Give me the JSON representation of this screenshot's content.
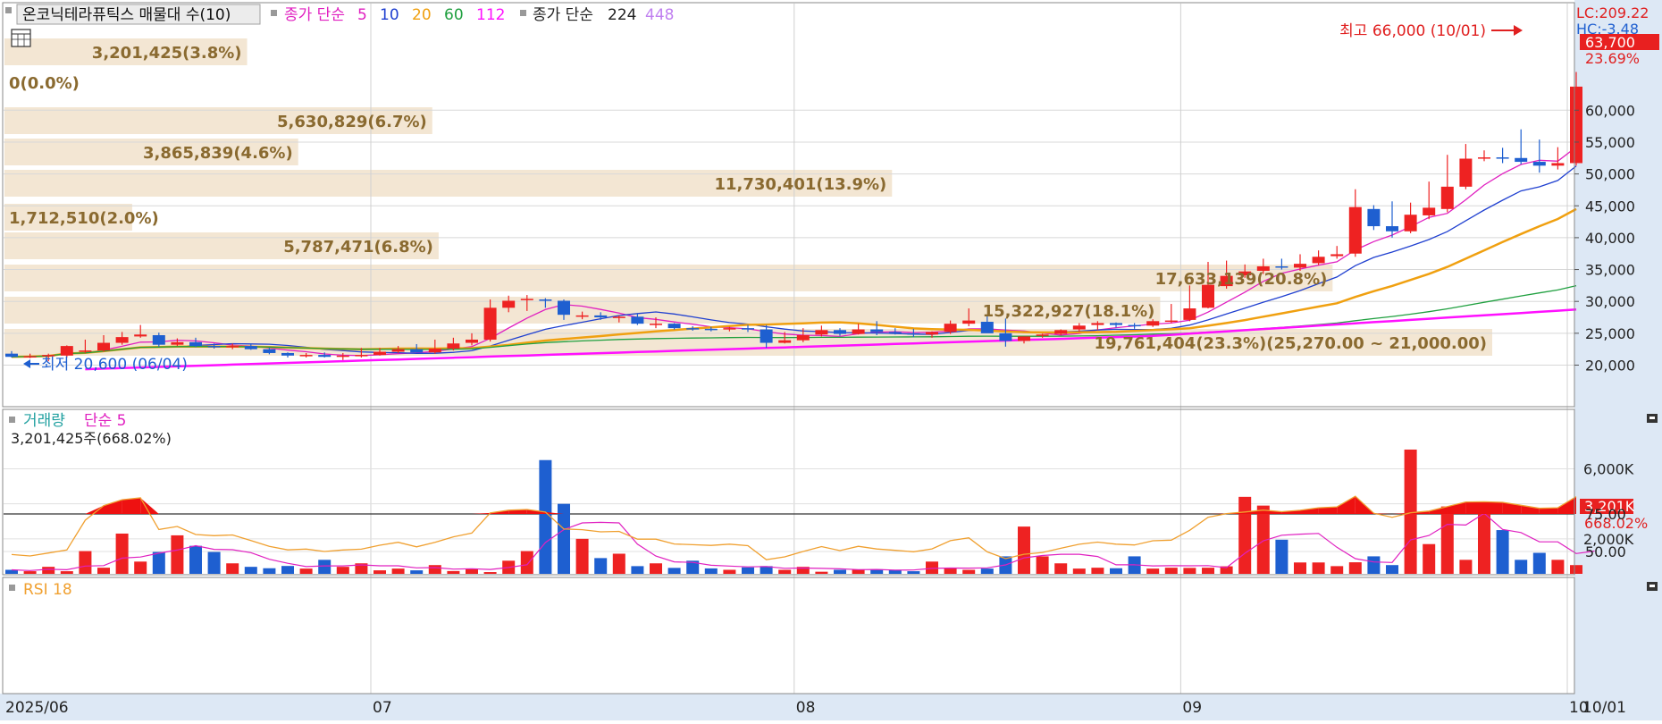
{
  "legend": {
    "stock_name": "온코닉테라퓨틱스 매물대 수(10)",
    "ma_prefix": "종가 단순",
    "ma_periods": [
      "5",
      "10",
      "20",
      "60",
      "112"
    ],
    "ma2_prefix": "종가 단순",
    "ma2_periods": [
      "224",
      "448"
    ]
  },
  "price_axis": {
    "ticks": [
      "60,000",
      "55,000",
      "50,000",
      "45,000",
      "40,000",
      "35,000",
      "30,000",
      "25,000",
      "20,000"
    ],
    "lc": "LC:209.22",
    "hc": "HC:-3.48",
    "current_price": "63,700",
    "change_pct": "23.69%"
  },
  "annotations": {
    "high": "최고 66,000 (10/01)",
    "low": "최저 20,600 (06/04)"
  },
  "volume_profile": [
    {
      "label": "3,201,425(3.8%)",
      "pct": 3.8
    },
    {
      "label": "0(0.0%)",
      "pct": 0.0
    },
    {
      "label": "5,630,829(6.7%)",
      "pct": 6.7
    },
    {
      "label": "3,865,839(4.6%)",
      "pct": 4.6
    },
    {
      "label": "11,730,401(13.9%)",
      "pct": 13.9
    },
    {
      "label": "1,712,510(2.0%)",
      "pct": 2.0
    },
    {
      "label": "5,787,471(6.8%)",
      "pct": 6.8
    },
    {
      "label": "17,633,139(20.8%)",
      "pct": 20.8
    },
    {
      "label": "15,322,927(18.1%)",
      "pct": 18.1
    },
    {
      "label": "19,761,404(23.3%)(25,270.00 ~ 21,000.00)",
      "pct": 23.3
    }
  ],
  "volume_panel": {
    "legend_a": "거래량",
    "legend_b": "단순 5",
    "info": "3,201,425주(668.02%)",
    "ticks": [
      "6,000K",
      "4,000K",
      "2,000K"
    ],
    "current": "3,201K",
    "current_pct": "668.02%"
  },
  "rsi_panel": {
    "legend": "RSI 18",
    "ticks": [
      "75.00",
      "50.00"
    ]
  },
  "x_axis": {
    "labels": [
      "2025/06",
      "07",
      "08",
      "09",
      "10"
    ],
    "end_label": "10/01"
  },
  "colors": {
    "up": "#ee2222",
    "down": "#1e5fd0",
    "ma5": "#e020c0",
    "ma10": "#2040d0",
    "ma20": "#f0a010",
    "ma60": "#20a040",
    "ma112": "#ff10ff",
    "ma224": "#222222",
    "ma448": "#c080f0",
    "profile": "#f3e6d3",
    "rsi": "#f0a030"
  },
  "chart_data": {
    "type": "candlestick",
    "title": "온코닉테라퓨틱스",
    "x": [
      "06/02",
      "06/03",
      "06/04",
      "06/05",
      "06/09",
      "06/10",
      "06/11",
      "06/12",
      "06/13",
      "06/16",
      "06/17",
      "06/18",
      "06/19",
      "06/20",
      "06/23",
      "06/24",
      "06/25",
      "06/26",
      "06/27",
      "06/30",
      "07/01",
      "07/02",
      "07/03",
      "07/04",
      "07/07",
      "07/08",
      "07/09",
      "07/10",
      "07/11",
      "07/14",
      "07/15",
      "07/16",
      "07/17",
      "07/18",
      "07/21",
      "07/22",
      "07/23",
      "07/24",
      "07/25",
      "07/28",
      "07/29",
      "07/30",
      "07/31",
      "08/01",
      "08/04",
      "08/05",
      "08/06",
      "08/07",
      "08/08",
      "08/11",
      "08/12",
      "08/13",
      "08/14",
      "08/18",
      "08/19",
      "08/20",
      "08/21",
      "08/22",
      "08/25",
      "08/26",
      "08/27",
      "08/28",
      "08/29",
      "09/01",
      "09/02",
      "09/03",
      "09/04",
      "09/05",
      "09/08",
      "09/09",
      "09/10",
      "09/11",
      "09/12",
      "09/15",
      "09/16",
      "09/17",
      "09/18",
      "09/19",
      "09/22",
      "09/23",
      "09/24",
      "09/25",
      "09/26",
      "09/29",
      "09/30",
      "10/01"
    ],
    "open": [
      21800,
      21300,
      21400,
      21500,
      22200,
      22300,
      23500,
      24500,
      24700,
      23200,
      23600,
      23000,
      22900,
      23000,
      22500,
      21900,
      21500,
      21600,
      21300,
      21500,
      21600,
      22100,
      22500,
      22000,
      22600,
      23500,
      24000,
      29000,
      30200,
      30300,
      30100,
      27800,
      27800,
      27500,
      27600,
      26500,
      26500,
      25800,
      25700,
      25600,
      25800,
      25600,
      23500,
      23900,
      24800,
      25500,
      24900,
      25600,
      25200,
      25000,
      24800,
      25200,
      26500,
      26800,
      25000,
      23800,
      24600,
      24900,
      25600,
      26300,
      26600,
      26300,
      26200,
      26900,
      27100,
      29000,
      32400,
      34100,
      34800,
      35500,
      35300,
      36000,
      37100,
      37500,
      44500,
      41800,
      41000,
      43500,
      44500,
      48000,
      52500,
      52600,
      52500,
      51900,
      51300,
      51700
    ],
    "high": [
      22200,
      21800,
      21800,
      23100,
      24000,
      24700,
      25200,
      26300,
      25100,
      24200,
      24300,
      23400,
      23400,
      23400,
      22700,
      22000,
      21900,
      22000,
      21900,
      22700,
      22700,
      23000,
      23300,
      24000,
      24300,
      25000,
      30300,
      30900,
      31000,
      30500,
      30300,
      28400,
      28300,
      27800,
      28100,
      27500,
      26600,
      26100,
      26000,
      26000,
      26300,
      26300,
      25200,
      25800,
      26200,
      25800,
      26500,
      26900,
      25800,
      25700,
      25300,
      27000,
      28900,
      27800,
      27300,
      24500,
      24900,
      25600,
      26600,
      26900,
      26700,
      26600,
      27200,
      29600,
      32500,
      36200,
      36400,
      35800,
      36700,
      36700,
      37400,
      38000,
      38700,
      47600,
      45100,
      45700,
      45500,
      48800,
      53000,
      54700,
      53700,
      54100,
      57000,
      55400,
      54200,
      66000
    ],
    "low": [
      21200,
      21100,
      20600,
      21200,
      21900,
      22100,
      23200,
      24300,
      22900,
      23000,
      22800,
      22600,
      22500,
      22400,
      21700,
      21200,
      21200,
      21200,
      20800,
      21200,
      21500,
      21900,
      22200,
      21800,
      22300,
      23100,
      23700,
      28300,
      28500,
      29000,
      27100,
      27200,
      27100,
      26700,
      26300,
      25800,
      25600,
      25400,
      25300,
      25300,
      25200,
      22700,
      23400,
      23600,
      24500,
      24600,
      24800,
      24700,
      24800,
      24400,
      24300,
      24900,
      26100,
      25800,
      22900,
      23400,
      24300,
      24700,
      25200,
      25500,
      25900,
      25700,
      26000,
      26600,
      26900,
      28900,
      32000,
      33700,
      34300,
      35000,
      34800,
      35700,
      36700,
      37000,
      41200,
      40000,
      40700,
      42900,
      44000,
      47600,
      52000,
      51700,
      51500,
      50200,
      50700,
      51300
    ],
    "close": [
      21300,
      21400,
      21600,
      23000,
      22300,
      23500,
      24400,
      24800,
      23200,
      23600,
      23000,
      22900,
      23000,
      22500,
      21900,
      21500,
      21600,
      21300,
      21500,
      21600,
      22100,
      22500,
      22000,
      22600,
      23400,
      24000,
      29000,
      30100,
      30400,
      30100,
      27900,
      27800,
      27500,
      27600,
      26500,
      26500,
      25800,
      25700,
      25600,
      25800,
      25600,
      23500,
      23900,
      24700,
      25500,
      24900,
      25600,
      25200,
      25000,
      24800,
      25200,
      26500,
      27000,
      25000,
      23800,
      24500,
      24800,
      25500,
      26200,
      26600,
      26300,
      26200,
      26900,
      27000,
      28900,
      32600,
      34000,
      34700,
      35500,
      35300,
      35900,
      37000,
      37400,
      44800,
      41800,
      41000,
      43600,
      44700,
      48000,
      52400,
      52600,
      52500,
      51900,
      51300,
      51700,
      63700
    ],
    "volume_k": [
      230,
      150,
      400,
      150,
      1300,
      350,
      2300,
      700,
      1250,
      2200,
      1600,
      1250,
      600,
      400,
      320,
      450,
      300,
      800,
      400,
      600,
      200,
      300,
      200,
      500,
      160,
      300,
      100,
      750,
      1300,
      6500,
      4000,
      2000,
      900,
      1150,
      440,
      600,
      340,
      750,
      310,
      230,
      370,
      440,
      230,
      400,
      120,
      230,
      230,
      260,
      230,
      150,
      700,
      330,
      230,
      300,
      1000,
      2700,
      1000,
      600,
      300,
      350,
      320,
      1000,
      300,
      350,
      340,
      350,
      430,
      4400,
      3900,
      1950,
      650,
      650,
      440,
      660,
      1000,
      500,
      7100,
      1700,
      3850,
      800,
      3850,
      2500,
      800,
      1200,
      800,
      500,
      3201
    ],
    "ylim": [
      17000,
      67000
    ]
  }
}
